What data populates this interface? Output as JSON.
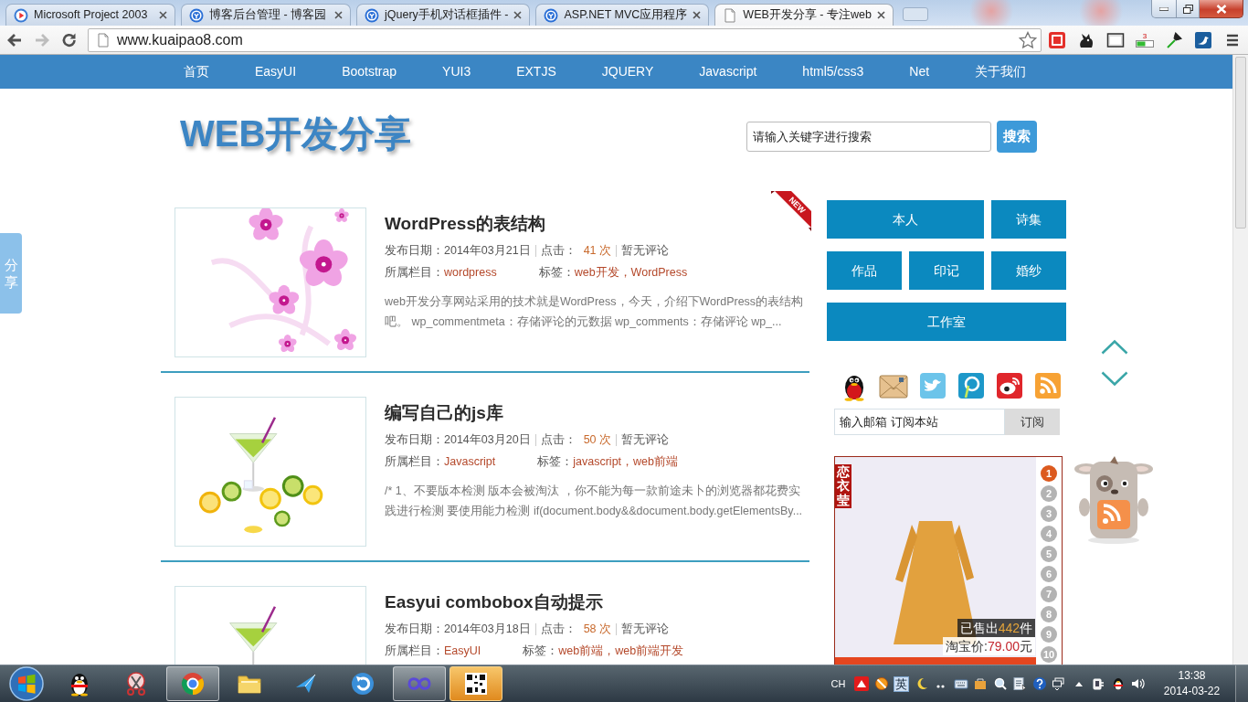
{
  "browser": {
    "tabs": [
      {
        "title": "Microsoft Project 2003",
        "selected": false
      },
      {
        "title": "博客后台管理 - 博客园",
        "selected": false
      },
      {
        "title": "jQuery手机对话框插件 -",
        "selected": false
      },
      {
        "title": "ASP.NET MVC应用程序",
        "selected": false
      },
      {
        "title": "WEB开发分享 - 专注web",
        "selected": true
      }
    ],
    "nav_buttons": [
      {
        "kind": "back",
        "disabled": false
      },
      {
        "kind": "forward",
        "disabled": true
      },
      {
        "kind": "reload",
        "disabled": false
      }
    ],
    "address": "www.kuaipao8.com",
    "extension_badge": "3"
  },
  "site": {
    "nav": [
      "首页",
      "EasyUI",
      "Bootstrap",
      "YUI3",
      "EXTJS",
      "JQUERY",
      "Javascript",
      "html5/css3",
      "Net",
      "关于我们"
    ],
    "logo": "WEB开发分享",
    "search": {
      "placeholder": "请输入关键字进行搜索",
      "button": "搜索"
    },
    "share_tab": "分享",
    "posts": [
      {
        "title": "WordPress的表结构",
        "badge": "NEW",
        "date": "发布日期：2014年03月21日",
        "views_label": "点击：",
        "views": "41 次",
        "comments": "暂无评论",
        "category_label": "所属栏目：",
        "category": "wordpress",
        "tags_label": "标签：",
        "tags": "web开发，WordPress",
        "excerpt": "web开发分享网站采用的技术就是WordPress，今天，介绍下WordPress的表结构吧。 wp_commentmeta：存储评论的元数据 wp_comments：存储评论 wp_..."
      },
      {
        "title": "编写自己的js库",
        "date": "发布日期：2014年03月20日",
        "views_label": "点击：",
        "views": "50 次",
        "comments": "暂无评论",
        "category_label": "所属栏目：",
        "category": "Javascript",
        "tags_label": "标签：",
        "tags": "javascript，web前端",
        "excerpt": "/* 1、不要版本检测 版本会被淘汰 ，你不能为每一款前途未卜的浏览器都花费实践进行检测 要使用能力检测 if(document.body&&document.body.getElementsBy..."
      },
      {
        "title": "Easyui combobox自动提示",
        "date": "发布日期：2014年03月18日",
        "views_label": "点击：",
        "views": "58 次",
        "comments": "暂无评论",
        "category_label": "所属栏目：",
        "category": "EasyUI",
        "tags_label": "标签：",
        "tags": "web前端，web前端开发"
      }
    ],
    "sidebar": {
      "links": [
        [
          "本人",
          "诗集"
        ],
        [
          "作品",
          "印记",
          "婚纱"
        ],
        [
          "工作室"
        ]
      ],
      "subscribe": {
        "placeholder": "输入邮箱 订阅本站",
        "button": "订阅"
      }
    },
    "ad": {
      "brand": "恋衣莹",
      "sold": {
        "before": "已售出",
        "count": "442",
        "after": "件"
      },
      "price": {
        "label": "淘宝价:",
        "amount": "79.00",
        "unit": "元"
      },
      "pages": [
        {
          "label": "1",
          "selected": true
        },
        {
          "label": "2",
          "selected": false
        },
        {
          "label": "3",
          "selected": false
        },
        {
          "label": "4",
          "selected": false
        },
        {
          "label": "5",
          "selected": false
        },
        {
          "label": "6",
          "selected": false
        },
        {
          "label": "7",
          "selected": false
        },
        {
          "label": "8",
          "selected": false
        },
        {
          "label": "9",
          "selected": false
        },
        {
          "label": "10",
          "selected": false
        }
      ]
    }
  },
  "taskbar": {
    "apps": [
      {
        "open": false,
        "flashing": false
      },
      {
        "open": false,
        "flashing": false
      },
      {
        "open": true,
        "flashing": false
      },
      {
        "open": false,
        "flashing": false
      },
      {
        "open": false,
        "flashing": false
      },
      {
        "open": false,
        "flashing": false
      },
      {
        "open": true,
        "flashing": false
      },
      {
        "open": true,
        "flashing": true
      }
    ],
    "input_language": "CH",
    "ime_mode": "英",
    "time": "13:38",
    "date": "2014-03-22"
  }
}
